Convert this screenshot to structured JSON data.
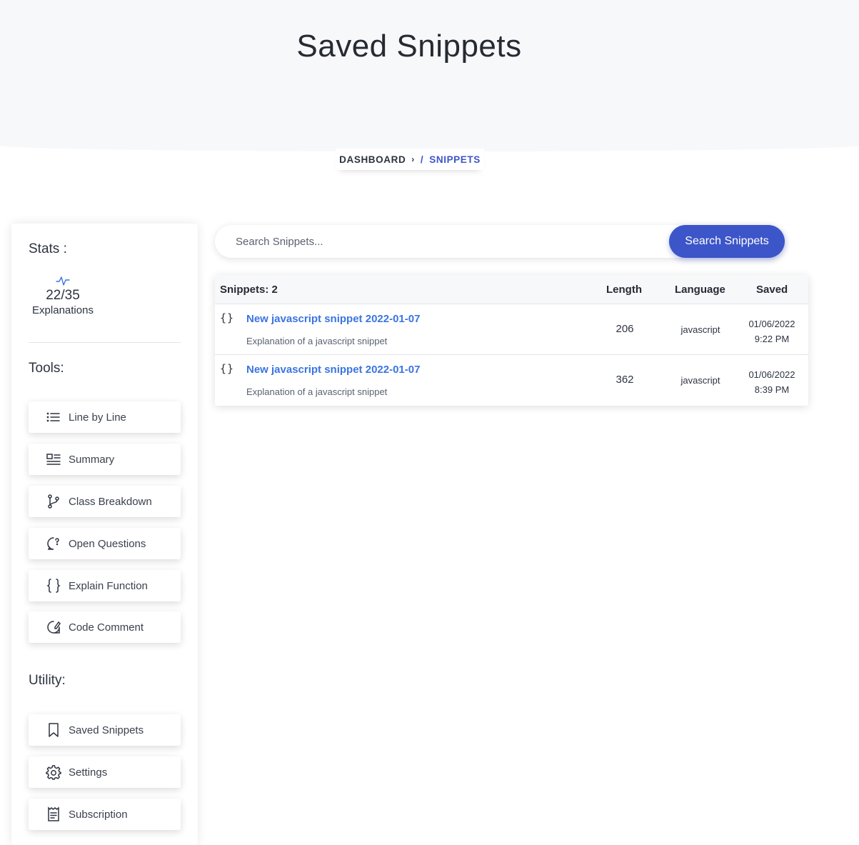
{
  "page": {
    "title": "Saved Snippets"
  },
  "breadcrumb": {
    "home": "DASHBOARD",
    "separator": "›",
    "slash": "/",
    "current": "SNIPPETS"
  },
  "sidebar": {
    "stats_title": "Stats :",
    "stat": {
      "value": "22/35",
      "label": "Explanations",
      "icon": "activity-icon"
    },
    "tools_title": "Tools:",
    "tools": [
      {
        "label": "Line by Line",
        "icon": "list-icon"
      },
      {
        "label": "Summary",
        "icon": "summary-icon"
      },
      {
        "label": "Class Breakdown",
        "icon": "git-branch-icon"
      },
      {
        "label": "Open Questions",
        "icon": "question-bubble-icon"
      },
      {
        "label": "Explain Function",
        "icon": "braces-icon"
      },
      {
        "label": "Code Comment",
        "icon": "comment-edit-icon"
      }
    ],
    "utility_title": "Utility:",
    "utility": [
      {
        "label": "Saved Snippets",
        "icon": "bookmark-icon"
      },
      {
        "label": "Settings",
        "icon": "gear-icon"
      },
      {
        "label": "Subscription",
        "icon": "receipt-icon"
      }
    ]
  },
  "search": {
    "placeholder": "Search Snippets...",
    "value": "",
    "button_label": "Search Snippets"
  },
  "table": {
    "headers": {
      "count": "Snippets: 2",
      "length": "Length",
      "language": "Language",
      "saved": "Saved"
    },
    "rows": [
      {
        "icon": "{}",
        "title": "New javascript snippet 2022-01-07",
        "description": "Explanation of a javascript snippet",
        "length": "206",
        "language": "javascript",
        "saved_date": "01/06/2022",
        "saved_time": "9:22 PM"
      },
      {
        "icon": "{}",
        "title": "New javascript snippet 2022-01-07",
        "description": "Explanation of a javascript snippet",
        "length": "362",
        "language": "javascript",
        "saved_date": "01/06/2022",
        "saved_time": "8:39 PM"
      }
    ]
  },
  "colors": {
    "accent": "#3c55c8",
    "link": "#3a74e0",
    "hero_bg": "#f7f8fa"
  }
}
